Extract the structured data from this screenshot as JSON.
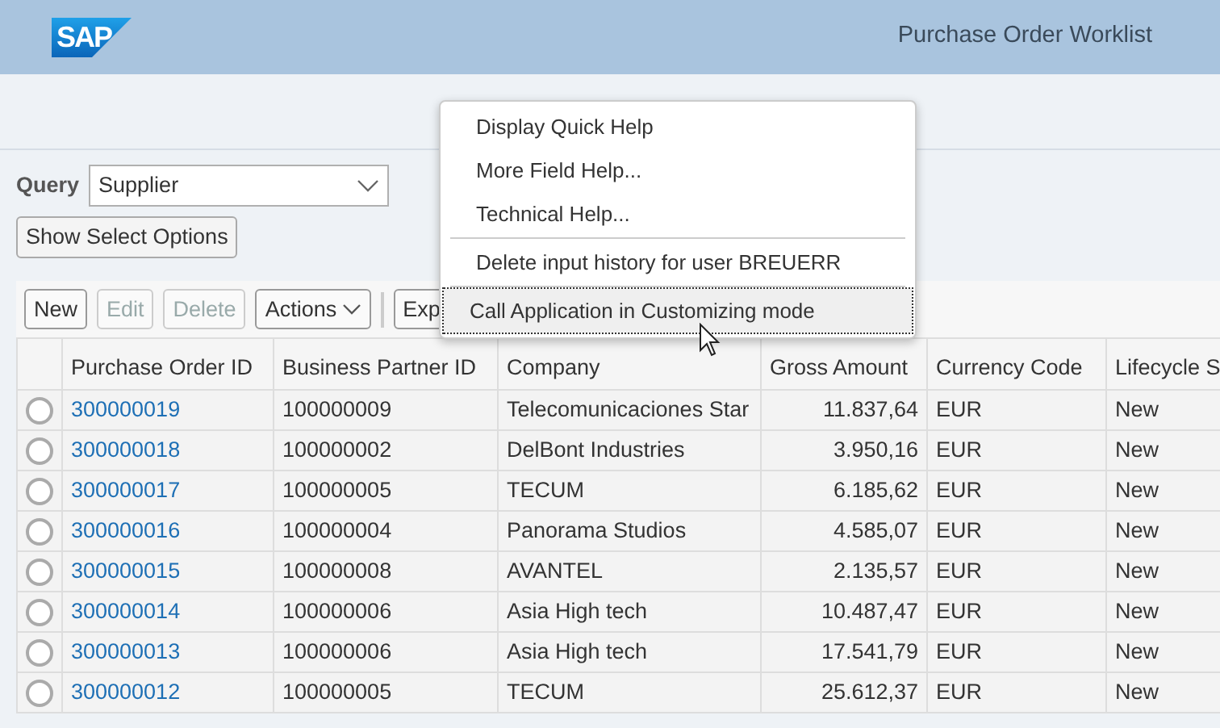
{
  "header": {
    "logo": "SAP",
    "title": "Purchase Order Worklist"
  },
  "query": {
    "label": "Query",
    "value": "Supplier"
  },
  "show_select_options": "Show Select Options",
  "toolbar": [
    {
      "label": "New",
      "disabled": false,
      "kind": "button"
    },
    {
      "label": "Edit",
      "disabled": true,
      "kind": "button"
    },
    {
      "label": "Delete",
      "disabled": true,
      "kind": "button"
    },
    {
      "label": "Actions",
      "disabled": false,
      "kind": "dropdown"
    },
    {
      "label": "Exp",
      "disabled": false,
      "kind": "cut"
    }
  ],
  "table": {
    "columns": [
      "Purchase Order ID",
      "Business Partner ID",
      "Company",
      "Gross Amount",
      "Currency Code",
      "Lifecycle S"
    ],
    "rows": [
      {
        "selected": false,
        "cells": [
          "300000019",
          "100000009",
          "Telecomunicaciones Star",
          "11.837,64",
          "EUR",
          "New"
        ]
      },
      {
        "selected": false,
        "cells": [
          "300000018",
          "100000002",
          "DelBont Industries",
          "3.950,16",
          "EUR",
          "New"
        ]
      },
      {
        "selected": false,
        "cells": [
          "300000017",
          "100000005",
          "TECUM",
          "6.185,62",
          "EUR",
          "New"
        ]
      },
      {
        "selected": false,
        "cells": [
          "300000016",
          "100000004",
          "Panorama Studios",
          "4.585,07",
          "EUR",
          "New"
        ]
      },
      {
        "selected": false,
        "cells": [
          "300000015",
          "100000008",
          "AVANTEL",
          "2.135,57",
          "EUR",
          "New"
        ]
      },
      {
        "selected": false,
        "cells": [
          "300000014",
          "100000006",
          "Asia High tech",
          "10.487,47",
          "EUR",
          "New"
        ]
      },
      {
        "selected": false,
        "cells": [
          "300000013",
          "100000006",
          "Asia High tech",
          "17.541,79",
          "EUR",
          "New"
        ]
      },
      {
        "selected": false,
        "cells": [
          "300000012",
          "100000005",
          "TECUM",
          "25.612,37",
          "EUR",
          "New"
        ]
      }
    ]
  },
  "context_menu": [
    {
      "label": "Display Quick Help",
      "focused": false
    },
    {
      "label": "More Field Help...",
      "focused": false
    },
    {
      "label": "Technical Help...",
      "focused": false
    },
    {
      "label": "Delete input history for user BREUERR",
      "focused": false
    },
    {
      "label": "Call Application in Customizing mode",
      "focused": true
    }
  ]
}
